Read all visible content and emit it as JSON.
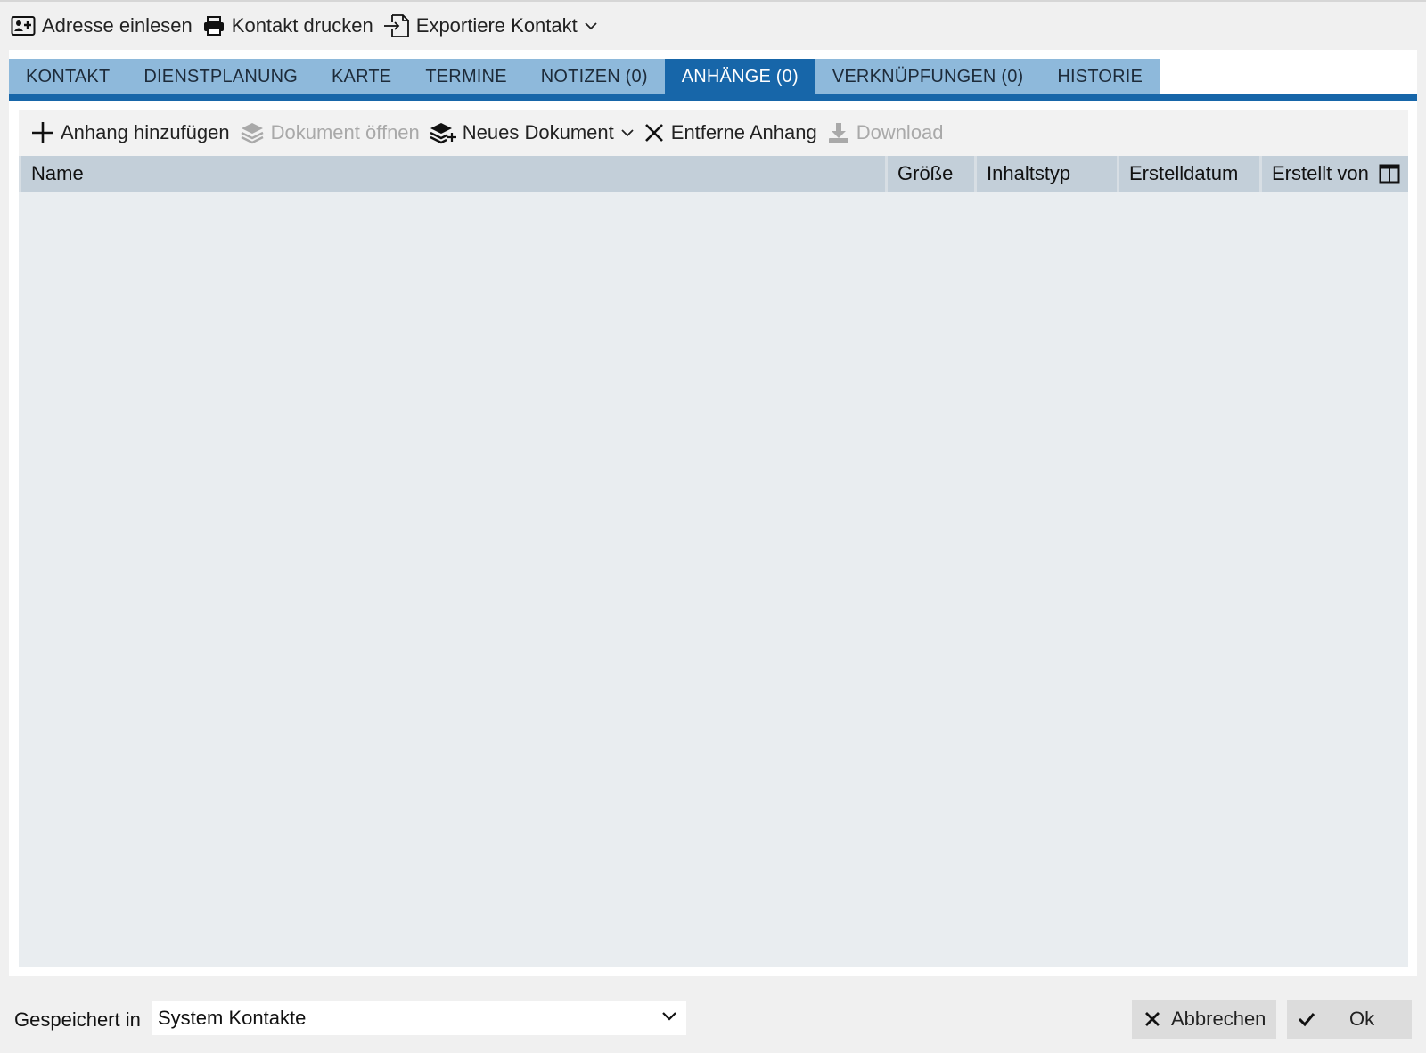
{
  "toolbar": {
    "read_address": "Adresse einlesen",
    "print_contact": "Kontakt drucken",
    "export_contact": "Exportiere Kontakt"
  },
  "tabs": [
    {
      "label": "KONTAKT",
      "active": false
    },
    {
      "label": "DIENSTPLANUNG",
      "active": false
    },
    {
      "label": "KARTE",
      "active": false
    },
    {
      "label": "TERMINE",
      "active": false
    },
    {
      "label": "NOTIZEN (0)",
      "active": false
    },
    {
      "label": "ANHÄNGE (0)",
      "active": true
    },
    {
      "label": "VERKNÜPFUNGEN (0)",
      "active": false
    },
    {
      "label": "HISTORIE",
      "active": false
    }
  ],
  "attachments_toolbar": {
    "add": "Anhang hinzufügen",
    "open": "Dokument öffnen",
    "new_document": "Neues Dokument",
    "remove": "Entferne Anhang",
    "download": "Download"
  },
  "grid": {
    "columns": [
      "Name",
      "Größe",
      "Inhaltstyp",
      "Erstelldatum",
      "Erstellt von"
    ],
    "rows": []
  },
  "footer": {
    "saved_in_label": "Gespeichert in",
    "saved_in_value": "System Kontakte",
    "cancel": "Abbrechen",
    "ok": "Ok"
  },
  "colors": {
    "tab_inactive": "#8eb9db",
    "tab_active": "#1766a9",
    "grid_header": "#c3cfd9",
    "grid_body": "#e9edf0",
    "disabled_text": "#a9a9a9"
  }
}
